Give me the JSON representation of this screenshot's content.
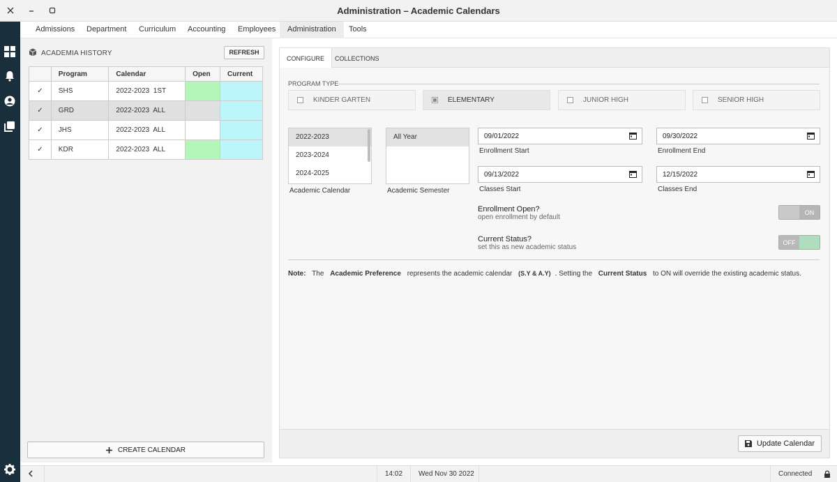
{
  "window": {
    "title": "Administration – Academic Calendars"
  },
  "menu": {
    "items": [
      "Admissions",
      "Department",
      "Curriculum",
      "Accounting",
      "Employees",
      "Administration",
      "Tools"
    ],
    "active": "Administration"
  },
  "sidebar": {
    "icons": [
      "dashboard-icon",
      "notifications-icon",
      "user-icon",
      "copy-icon"
    ],
    "bottom_icon": "settings-icon"
  },
  "history": {
    "header": "ACADEMIA HISTORY",
    "refresh_label": "REFRESH",
    "columns": [
      "",
      "Program",
      "Calendar",
      "Open",
      "Current"
    ],
    "rows": [
      {
        "check": "✓",
        "program": "SHS",
        "calendar": "2022-2023  1ST",
        "open": "#b4f5b8",
        "current": "#bcf6fb",
        "selected": false
      },
      {
        "check": "✓",
        "program": "GRD",
        "calendar": "2022-2023  ALL",
        "open": "",
        "current": "#bcf6fb",
        "selected": true
      },
      {
        "check": "✓",
        "program": "JHS",
        "calendar": "2022-2023  ALL",
        "open": "#ffffff",
        "current": "#bcf6fb",
        "selected": false
      },
      {
        "check": "✓",
        "program": "KDR",
        "calendar": "2022-2023  ALL",
        "open": "#b4f5b8",
        "current": "#bcf6fb",
        "selected": false
      }
    ],
    "create_label": "CREATE CALENDAR"
  },
  "tabs": [
    "CONFIGURE",
    "COLLECTIONS"
  ],
  "program_type": {
    "label": "PROGRAM TYPE",
    "options": [
      {
        "label": "KINDER GARTEN",
        "checked": false
      },
      {
        "label": "ELEMENTARY",
        "checked": true
      },
      {
        "label": "JUNIOR HIGH",
        "checked": false
      },
      {
        "label": "SENIOR HIGH",
        "checked": false
      }
    ]
  },
  "academic_calendar": {
    "label": "Academic Calendar",
    "items": [
      "2022-2023",
      "2023-2024",
      "2024-2025"
    ],
    "selected": "2022-2023"
  },
  "academic_semester": {
    "label": "Academic Semester",
    "items": [
      "All Year"
    ],
    "selected": "All Year"
  },
  "dates": {
    "enrollment_start": {
      "value": "09/01/2022",
      "label": "Enrollment Start"
    },
    "enrollment_end": {
      "value": "09/30/2022",
      "label": "Enrollment End"
    },
    "classes_start": {
      "value": "09/13/2022",
      "label": "Classes Start"
    },
    "classes_end": {
      "value": "12/15/2022",
      "label": "Classes End"
    }
  },
  "enrollment_open": {
    "label": "Enrollment Open?",
    "sub": "open enrollment by default",
    "state_text": "ON",
    "on": true
  },
  "current_status": {
    "label": "Current Status?",
    "sub": "set this as new academic status",
    "state_text": "OFF",
    "on": false
  },
  "note": {
    "prefix": "Note:",
    "t1": "The",
    "b1": "Academic Preference",
    "t2": "represents the academic calendar",
    "b2": "(S.Y & A.Y)",
    "t3": ". Setting the",
    "b3": "Current Status",
    "t4": "to ON will override the existing academic status."
  },
  "update_label": "Update Calendar",
  "statusbar": {
    "time": "14:02",
    "date": "Wed Nov 30 2022",
    "connection": "Connected"
  },
  "colors": {
    "sidebar": "#1a2f3c",
    "open_green": "#b4f5b8",
    "current_cyan": "#bcf6fb",
    "toggle_on": "#b0dcc0",
    "toggle_off": "#c9c9c9"
  }
}
